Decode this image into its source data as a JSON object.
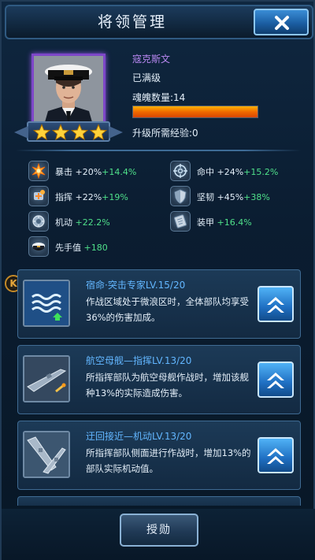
{
  "header": {
    "title": "将领管理",
    "close_label": ""
  },
  "officer": {
    "name": "寇克斯文",
    "level_status": "已满级",
    "soul_label": "魂魄数量:",
    "soul_count": "14",
    "soul_progress": 1.0,
    "exp_label": "升级所需经验:",
    "exp_value": "0",
    "stars": 4
  },
  "stats": [
    {
      "icon": "crit-icon",
      "name": "暴击",
      "base": "+20%",
      "bonus": "+14.4%"
    },
    {
      "icon": "crosshair-icon",
      "name": "命中",
      "base": "+24%",
      "bonus": "+15.2%"
    },
    {
      "icon": "command-icon",
      "name": "指挥",
      "base": "+22%",
      "bonus": "+19%"
    },
    {
      "icon": "shield-icon",
      "name": "坚韧",
      "base": "+45%",
      "bonus": "+38%"
    },
    {
      "icon": "mobility-icon",
      "name": "机动",
      "base": "",
      "bonus": "+22.2%"
    },
    {
      "icon": "armor-icon",
      "name": "装甲",
      "base": "",
      "bonus": "+16.4%"
    },
    {
      "icon": "cap-icon",
      "name": "先手值",
      "base": "",
      "bonus": "+180"
    }
  ],
  "k_badge": "K",
  "skills": [
    {
      "icon": "waves-icon",
      "title": "宿命·突击专家LV.15/20",
      "desc": "作战区域处于微浪区时，全体部队均享受36%的伤害加成。"
    },
    {
      "icon": "aircraft-carrier-icon",
      "title": "航空母舰—指挥LV.13/20",
      "desc": "所指挥部队为航空母舰作战时，增加该舰种13%的实际造成伤害。"
    },
    {
      "icon": "flanking-ships-icon",
      "title": "迂回接近—机动LV.13/20",
      "desc": "所指挥部队侧面进行作战时，增加13%的部队实际机动值。"
    }
  ],
  "peek_title": "",
  "bottom": {
    "medal_label": "授勋"
  },
  "colors": {
    "accent": "#62b6ff",
    "bonus": "#4fe08a",
    "name": "#b887f0",
    "bar": "#f06a00"
  }
}
